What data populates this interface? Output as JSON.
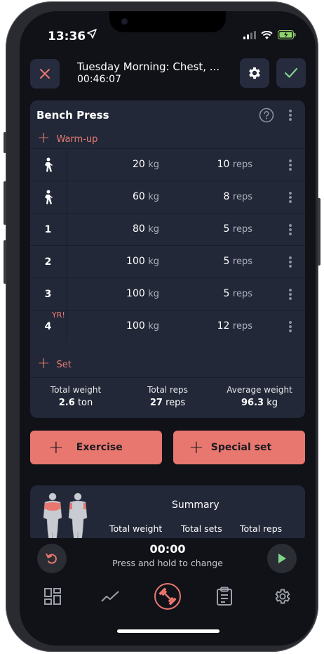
{
  "status_bar": {
    "time": "13:36"
  },
  "header": {
    "workout_title": "Tuesday Morning: Chest, ...",
    "elapsed": "00:46:07"
  },
  "exercise": {
    "name": "Bench Press",
    "warmup_label": "Warm-up",
    "add_set_label": "Set",
    "sets": [
      {
        "label": "",
        "kind": "warmup",
        "weight": "20",
        "weight_unit": "kg",
        "reps": "10",
        "reps_unit": "reps",
        "tag": ""
      },
      {
        "label": "",
        "kind": "warmup",
        "weight": "60",
        "weight_unit": "kg",
        "reps": "8",
        "reps_unit": "reps",
        "tag": ""
      },
      {
        "label": "1",
        "kind": "set",
        "weight": "80",
        "weight_unit": "kg",
        "reps": "5",
        "reps_unit": "reps",
        "tag": ""
      },
      {
        "label": "2",
        "kind": "set",
        "weight": "100",
        "weight_unit": "kg",
        "reps": "5",
        "reps_unit": "reps",
        "tag": ""
      },
      {
        "label": "3",
        "kind": "set",
        "weight": "100",
        "weight_unit": "kg",
        "reps": "5",
        "reps_unit": "reps",
        "tag": ""
      },
      {
        "label": "4",
        "kind": "set",
        "weight": "100",
        "weight_unit": "kg",
        "reps": "12",
        "reps_unit": "reps",
        "tag": "YR!"
      }
    ],
    "totals": {
      "weight_label": "Total weight",
      "weight_value": "2.6",
      "weight_unit": "ton",
      "reps_label": "Total reps",
      "reps_value": "27",
      "reps_unit": "reps",
      "avg_label": "Average weight",
      "avg_value": "96.3",
      "avg_unit": "kg"
    }
  },
  "actions": {
    "exercise_label": "Exercise",
    "special_set_label": "Special set"
  },
  "summary": {
    "title": "Summary",
    "col_weight": "Total weight",
    "col_sets": "Total sets",
    "col_reps": "Total reps"
  },
  "timer": {
    "value": "00:00",
    "hint": "Press and hold to change"
  },
  "nav": {
    "items": [
      "dashboard-icon",
      "chart-line-icon",
      "dumbbell-icon",
      "clipboard-icon",
      "gear-icon"
    ],
    "active_index": 2
  },
  "colors": {
    "accent": "#e8776f",
    "card": "#232838",
    "background": "#111218",
    "confirm": "#7fd38b"
  }
}
